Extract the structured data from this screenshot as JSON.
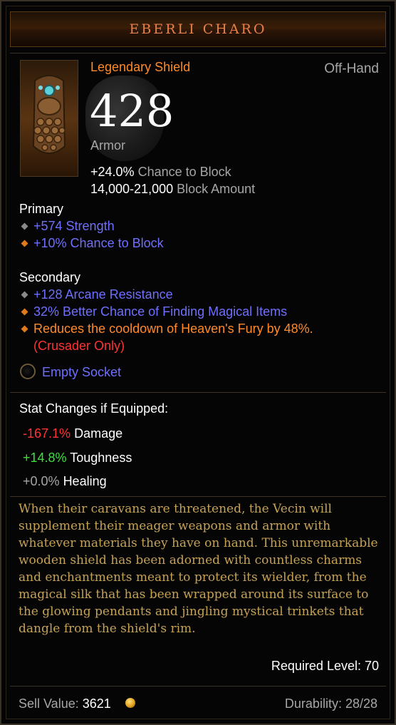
{
  "item": {
    "name": "EBERLI CHARO",
    "type": "Legendary Shield",
    "slot": "Off-Hand",
    "armor_value": "428",
    "armor_label": "Armor",
    "base_stats": [
      {
        "value": "+24.0%",
        "label": "Chance to Block"
      },
      {
        "value": "14,000-21,000",
        "label": "Block Amount"
      }
    ],
    "primary_label": "Primary",
    "primary": [
      {
        "text": "+574 Strength",
        "bullet": "gray"
      },
      {
        "text": "+10% Chance to Block",
        "bullet": "orange"
      }
    ],
    "secondary_label": "Secondary",
    "secondary": [
      {
        "text": "+128 Arcane Resistance",
        "bullet": "gray"
      },
      {
        "text": "32% Better Chance of Finding Magical Items",
        "bullet": "orange"
      },
      {
        "text": "Reduces the cooldown of Heaven's Fury by 48%.",
        "bullet": "orange"
      }
    ],
    "class_restriction": "(Crusader Only)",
    "socket_label": "Empty Socket",
    "stat_changes_label": "Stat Changes if Equipped:",
    "stat_changes": [
      {
        "value": "-167.1%",
        "label": "Damage",
        "color": "#ff3333"
      },
      {
        "value": "+14.8%",
        "label": "Toughness",
        "color": "#3ee03e"
      },
      {
        "value": "+0.0%",
        "label": "Healing",
        "color": "#a6a6a6"
      }
    ],
    "flavor_text": "When their caravans are threatened, the Vecin will supplement their meager weapons and armor with whatever materials they have on hand. This unremarkable wooden shield has been adorned with countless charms and enchantments meant to protect its wielder, from the magical silk that has been wrapped around its surface to the glowing pendants and jingling mystical trinkets that dangle from the shield's rim.",
    "required_level": "Required Level: 70",
    "sell_label": "Sell Value:",
    "sell_value": "3621",
    "durability": "Durability: 28/28",
    "icons": {
      "item": "shield-charm-icon",
      "coin": "gold-coin-icon",
      "socket": "empty-socket-icon"
    },
    "colors": {
      "legendary": "#ff8a2a",
      "magic": "#6f6fff",
      "flavor": "#c7a255",
      "negative": "#ff3333",
      "positive": "#3ee03e"
    }
  }
}
